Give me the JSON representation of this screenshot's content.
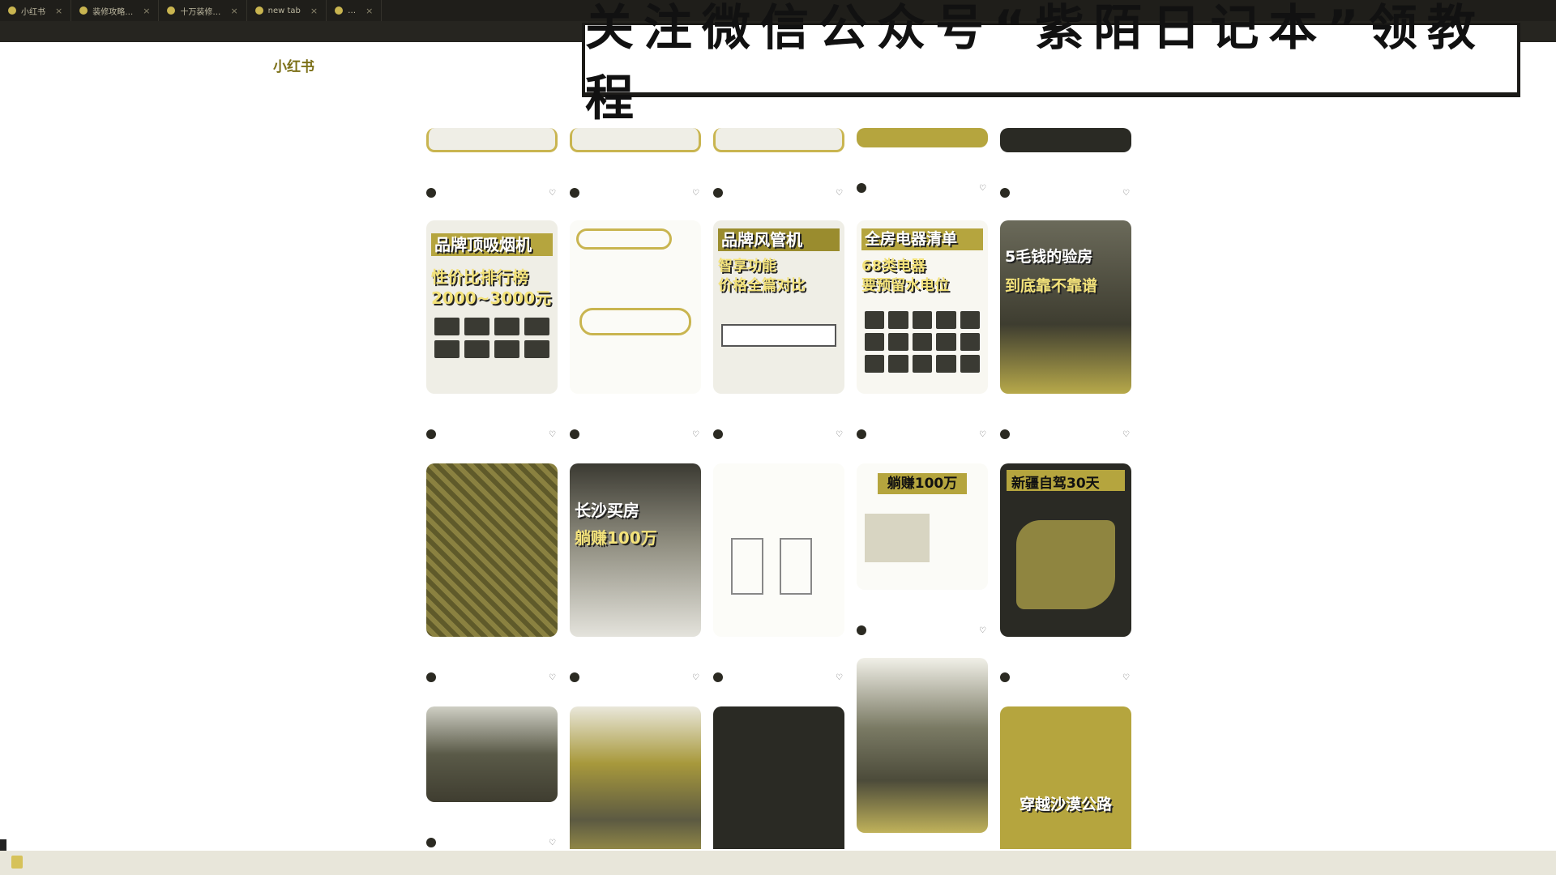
{
  "browser": {
    "tabs": [
      {
        "label": "小红书"
      },
      {
        "label": "装修攻略…"
      },
      {
        "label": "十万装修…"
      },
      {
        "label": "new tab"
      },
      {
        "label": "…"
      }
    ]
  },
  "banner": {
    "text": "关注微信公众号“紫陌日记本”领教程"
  },
  "logo": {
    "text": "小红书"
  },
  "cards": [
    {
      "cover": "",
      "title": "",
      "author": "",
      "likes": ""
    },
    {
      "cover": "",
      "title": "",
      "author": "",
      "likes": ""
    },
    {
      "cover": "",
      "title": "",
      "author": "",
      "likes": ""
    },
    {
      "cover": "",
      "title": "",
      "author": "",
      "likes": ""
    },
    {
      "cover": "",
      "title": "",
      "author": "",
      "likes": ""
    },
    {
      "cover_lines": [
        "品牌顶吸烟机",
        "性价比排行榜",
        "2000~3000元"
      ],
      "title": "",
      "author": "",
      "likes": ""
    },
    {
      "cover_lines": [],
      "title": "",
      "author": "",
      "likes": ""
    },
    {
      "cover_lines": [
        "品牌风管机",
        "智享功能",
        "价格全篇对比"
      ],
      "title": "",
      "author": "",
      "likes": ""
    },
    {
      "cover_lines": [
        "全房电器清单",
        "68类电器",
        "要预留水电位"
      ],
      "title": "",
      "author": "",
      "likes": ""
    },
    {
      "cover_lines": [
        "5毛钱的验房",
        "到底靠不靠谱"
      ],
      "title": "",
      "author": "",
      "likes": ""
    },
    {
      "cover_lines": [],
      "title": "",
      "author": "",
      "likes": ""
    },
    {
      "cover_lines": [
        "长沙买房",
        "躺赚100万"
      ],
      "title": "",
      "author": "",
      "likes": ""
    },
    {
      "cover_lines": [],
      "title": "",
      "author": "",
      "likes": ""
    },
    {
      "cover_lines": [
        "躺赚100万"
      ],
      "title": "",
      "author": "",
      "likes": ""
    },
    {
      "cover_lines": [
        "新疆自驾30天"
      ],
      "title": "",
      "author": "",
      "likes": ""
    },
    {
      "cover_lines": [],
      "title": "",
      "author": "",
      "likes": ""
    },
    {
      "cover_lines": [],
      "title": "",
      "author": "",
      "likes": ""
    },
    {
      "cover_lines": [],
      "title": "",
      "author": "",
      "likes": ""
    },
    {
      "cover_lines": [],
      "title": "",
      "author": "",
      "likes": ""
    },
    {
      "cover_lines": [
        "穿越沙漠公路"
      ],
      "title": "",
      "author": "",
      "likes": ""
    }
  ],
  "colors": {
    "accent": "#b5a53e",
    "dark": "#2a2a24"
  }
}
